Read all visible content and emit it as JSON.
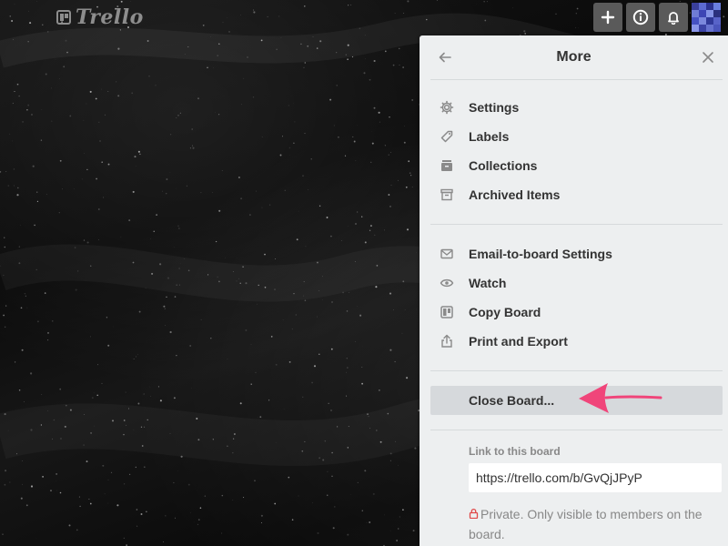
{
  "header": {
    "logo_text": "Trello",
    "buttons": [
      "plus-icon",
      "info-icon",
      "bell-icon"
    ]
  },
  "panel": {
    "title": "More",
    "group1": [
      {
        "label": "Settings",
        "icon": "gear-icon"
      },
      {
        "label": "Labels",
        "icon": "tag-icon"
      },
      {
        "label": "Collections",
        "icon": "collections-icon"
      },
      {
        "label": "Archived Items",
        "icon": "archive-icon"
      }
    ],
    "group2": [
      {
        "label": "Email-to-board Settings",
        "icon": "envelope-icon"
      },
      {
        "label": "Watch",
        "icon": "eye-icon"
      },
      {
        "label": "Copy Board",
        "icon": "board-icon"
      },
      {
        "label": "Print and Export",
        "icon": "share-icon"
      }
    ],
    "close_board_label": "Close Board...",
    "link_label": "Link to this board",
    "link_value": "https://trello.com/b/GvQjJPyP",
    "privacy_text": "Private. Only visible to members on the board."
  },
  "colors": {
    "accent_arrow": "#f0457a",
    "panel_bg": "#edeff0",
    "lock": "#e04848"
  }
}
